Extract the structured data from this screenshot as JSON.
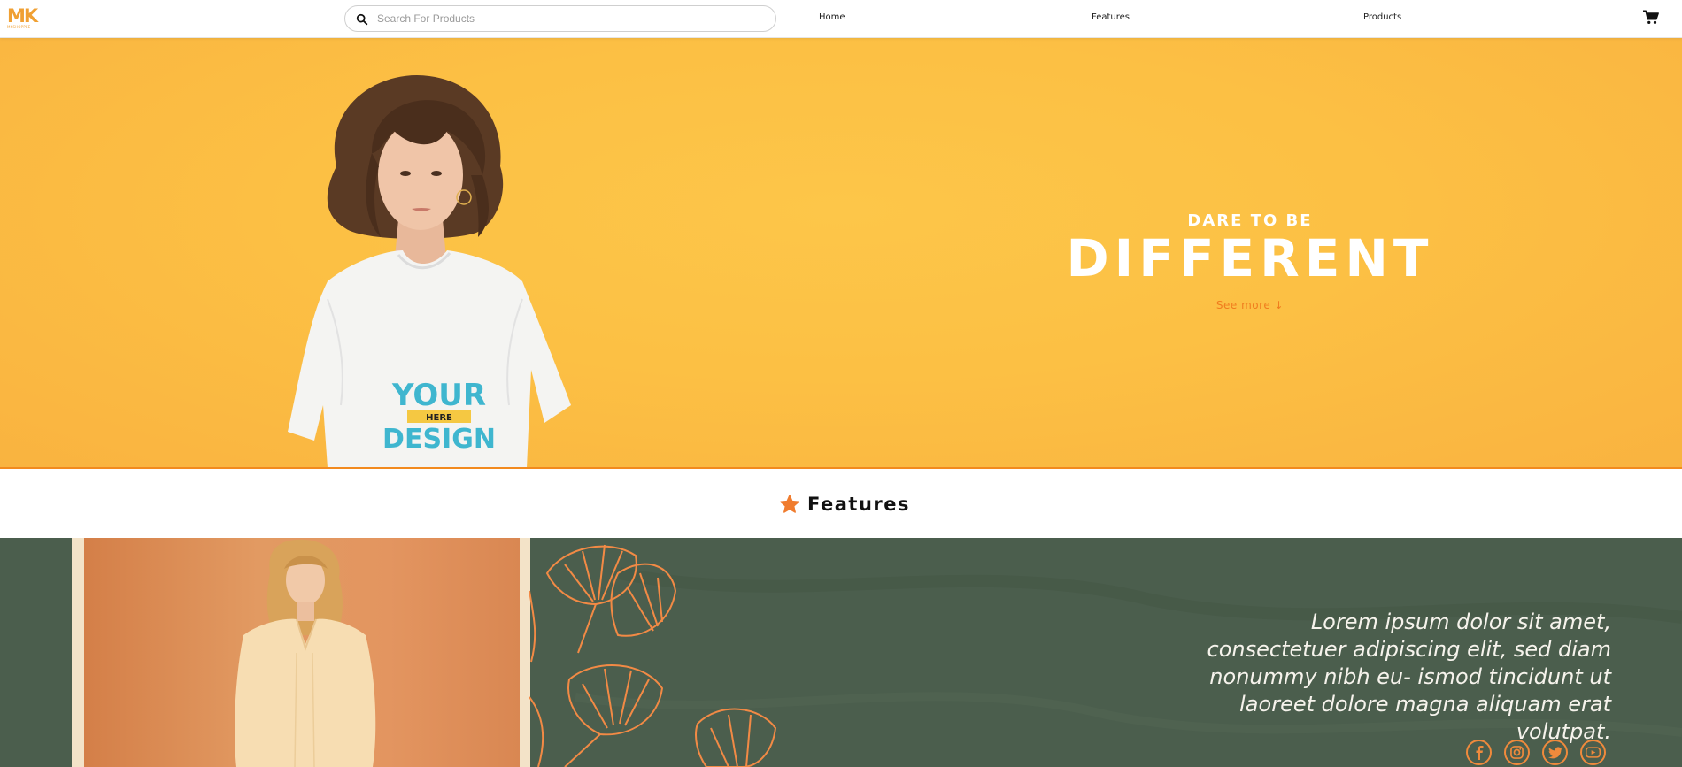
{
  "navbar": {
    "logo_text": "MK",
    "logo_subtext": "MKSHOPPEE",
    "search_placeholder": "Search For Products",
    "links": [
      "Home",
      "Features",
      "Products"
    ],
    "cart_icon": "cart-icon"
  },
  "hero": {
    "pre_title": "DARE TO BE",
    "title": "DIFFERENT",
    "link": "See more ↓",
    "background_color": "#fcc044",
    "accent_color": "#f07c1e",
    "shirt_print": {
      "top": "YOUR",
      "middle": "HERE",
      "bottom": "DESIGN"
    }
  },
  "features": {
    "title": "Features",
    "icon": "star-icon",
    "quote": "Lorem ipsum dolor sit amet, consectetuer adipiscing elit, sed diam nonummy nibh eu- ismod tincidunt ut laoreet dolore magna aliquam erat volutpat.",
    "background_color": "#4b5e4d",
    "social_icons": [
      "facebook-icon",
      "instagram-icon",
      "twitter-icon",
      "youtube-icon"
    ]
  }
}
